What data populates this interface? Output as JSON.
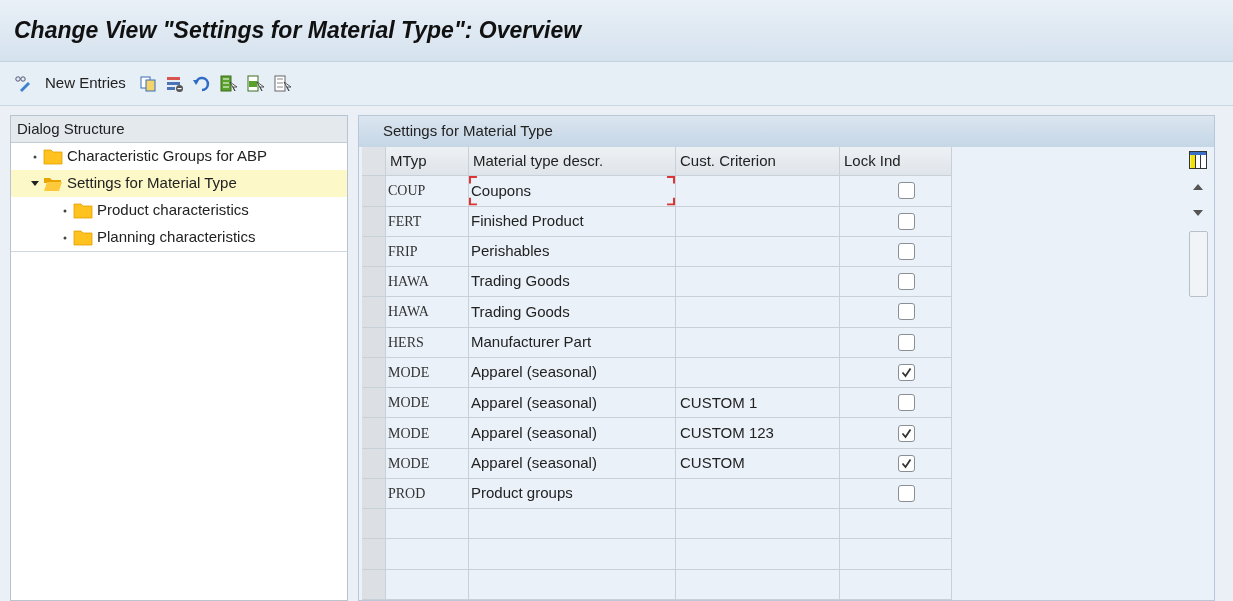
{
  "window": {
    "title": "Change View \"Settings for Material Type\": Overview"
  },
  "toolbar": {
    "items": [
      {
        "kind": "edit"
      },
      {
        "kind": "text",
        "label": "New Entries"
      },
      {
        "kind": "copy"
      },
      {
        "kind": "delete"
      },
      {
        "kind": "undo"
      },
      {
        "kind": "select-all"
      },
      {
        "kind": "select-block"
      },
      {
        "kind": "deselect"
      }
    ]
  },
  "dialog_structure": {
    "title": "Dialog Structure",
    "items": [
      {
        "label": "Characteristic Groups for ABP",
        "selected": false,
        "expanded": false
      },
      {
        "label": "Settings for Material Type",
        "selected": true,
        "expanded": true,
        "children": [
          {
            "label": "Product characteristics",
            "selected": false,
            "expanded": false
          },
          {
            "label": "Planning characteristics",
            "selected": false,
            "expanded": false
          }
        ]
      }
    ]
  },
  "table": {
    "title": "Settings for Material Type",
    "columns": [
      "MTyp",
      "Material type descr.",
      "Cust. Criterion",
      "Lock Ind"
    ],
    "rows": [
      {
        "mtyp": "COUP",
        "description": "Coupons",
        "lock": false,
        "focused": true
      },
      {
        "mtyp": "FERT",
        "description": "Finished Product",
        "lock": false,
        "focused": false
      },
      {
        "mtyp": "FRIP",
        "description": "Perishables",
        "lock": false,
        "focused": false
      },
      {
        "mtyp": "HAWA",
        "description": "Trading Goods",
        "lock": false,
        "focused": false
      },
      {
        "mtyp": "HAWA",
        "description": "Trading Goods",
        "lock": false,
        "focused": false
      },
      {
        "mtyp": "HERS",
        "description": "Manufacturer Part",
        "lock": false,
        "focused": false
      },
      {
        "mtyp": "MODE",
        "description": "Apparel (seasonal)",
        "lock": true,
        "focused": false
      },
      {
        "mtyp": "MODE",
        "description": "Apparel (seasonal)",
        "criterion": "CUSTOM 1",
        "lock": false,
        "focused": false
      },
      {
        "mtyp": "MODE",
        "description": "Apparel (seasonal)",
        "criterion": "CUSTOM 123",
        "lock": true,
        "focused": false
      },
      {
        "mtyp": "MODE",
        "description": "Apparel (seasonal)",
        "criterion": "CUSTOM",
        "lock": true,
        "focused": false
      },
      {
        "mtyp": "PROD",
        "description": "Product groups",
        "lock": false,
        "focused": false
      }
    ]
  }
}
